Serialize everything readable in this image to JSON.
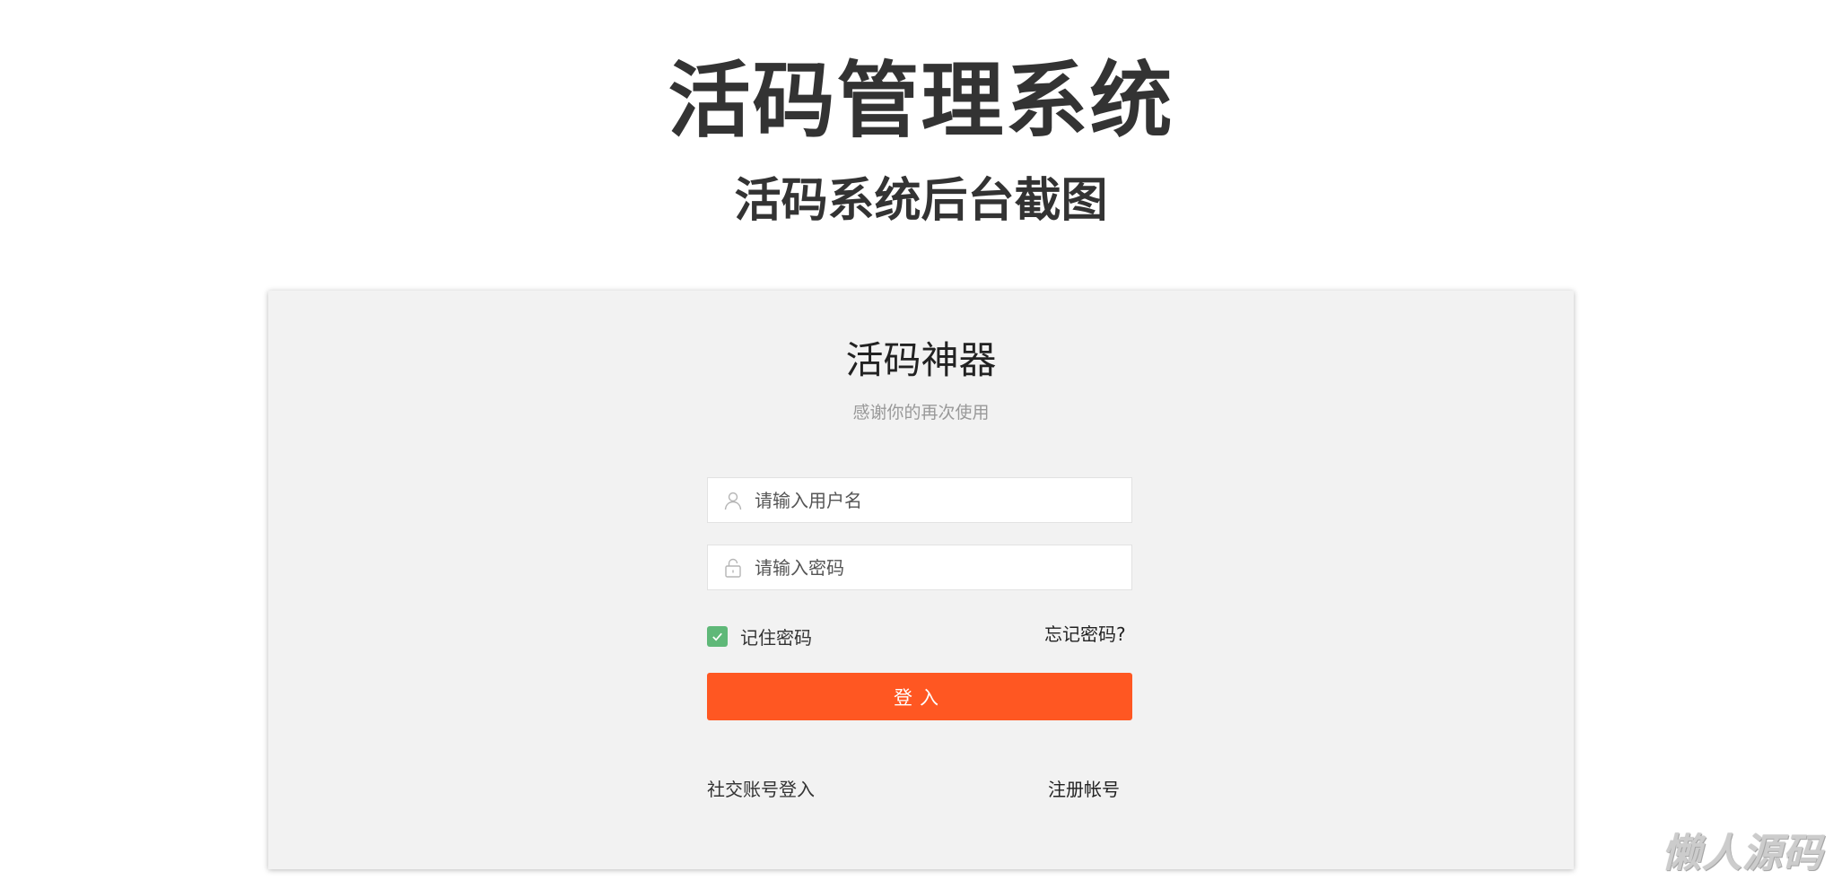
{
  "header": {
    "title": "活码管理系统",
    "subtitle": "活码系统后台截图"
  },
  "login": {
    "app_title": "活码神器",
    "app_subtitle": "感谢你的再次使用",
    "username": {
      "value": "",
      "placeholder": "请输入用户名",
      "icon": "user-icon"
    },
    "password": {
      "value": "",
      "placeholder": "请输入密码",
      "icon": "lock-icon"
    },
    "remember": {
      "label": "记住密码",
      "checked": true,
      "icon": "check-icon"
    },
    "forgot_label": "忘记密码?",
    "submit_label": "登入",
    "social_label": "社交账号登入",
    "register_label": "注册帐号"
  },
  "watermark": "懒人源码",
  "colors": {
    "accent": "#ff5722",
    "checkbox": "#5fb878",
    "panel_bg": "#f2f2f2",
    "title_text": "#333333"
  }
}
